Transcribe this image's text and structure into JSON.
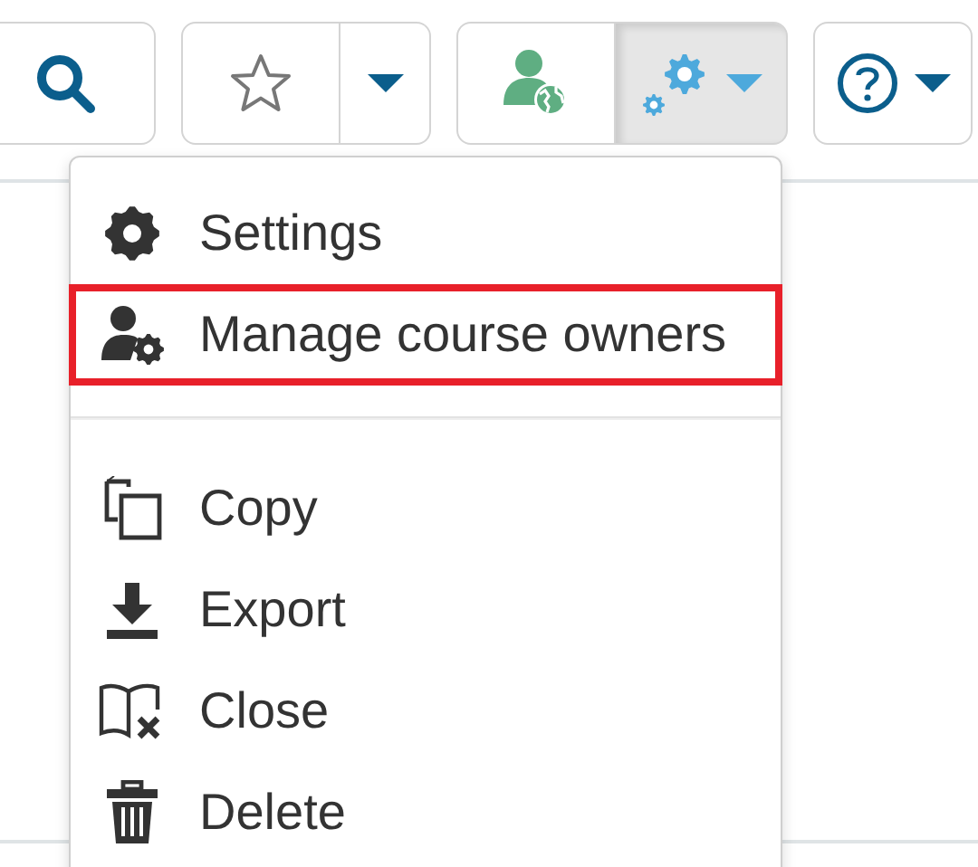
{
  "toolbar": {
    "groups": [
      {
        "buttons": [
          {
            "kind": "search",
            "pressed": false,
            "caret": false
          }
        ]
      },
      {
        "buttons": [
          {
            "kind": "star",
            "pressed": false,
            "caret": false
          },
          {
            "kind": "dropdown",
            "pressed": false,
            "caret": true
          }
        ]
      },
      {
        "buttons": [
          {
            "kind": "user-globe",
            "pressed": false,
            "caret": false
          },
          {
            "kind": "gears",
            "pressed": true,
            "caret": true
          }
        ]
      },
      {
        "buttons": [
          {
            "kind": "help",
            "pressed": false,
            "caret": true
          }
        ]
      }
    ]
  },
  "menu": {
    "items": [
      {
        "kind": "gear",
        "label": "Settings",
        "highlighted": false
      },
      {
        "kind": "user-gear",
        "label": "Manage course owners",
        "highlighted": true
      },
      {
        "kind": "divider"
      },
      {
        "kind": "copy",
        "label": "Copy",
        "highlighted": false
      },
      {
        "kind": "download",
        "label": "Export",
        "highlighted": false
      },
      {
        "kind": "book-x",
        "label": "Close",
        "highlighted": false
      },
      {
        "kind": "trash",
        "label": "Delete",
        "highlighted": false
      }
    ]
  }
}
